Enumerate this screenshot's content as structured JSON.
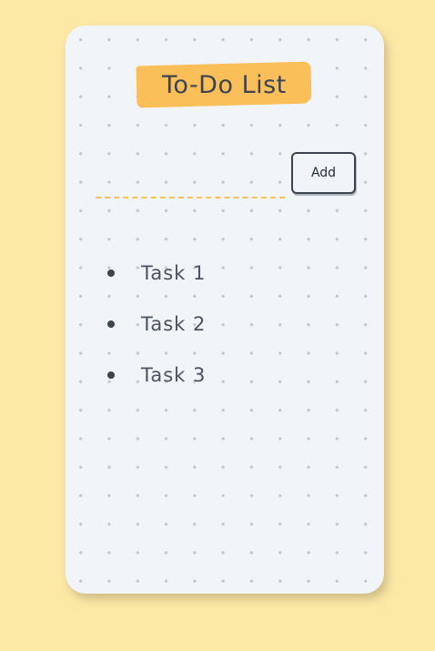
{
  "app": {
    "title": "To-Do List"
  },
  "form": {
    "input_value": "",
    "input_placeholder": "",
    "add_label": "Add"
  },
  "tasks": [
    {
      "label": "Task 1"
    },
    {
      "label": "Task 2"
    },
    {
      "label": "Task 3"
    }
  ],
  "colors": {
    "background": "#fde9a6",
    "card": "#f1f5f9",
    "accent": "#fbbf5a",
    "text": "#3c4452"
  }
}
